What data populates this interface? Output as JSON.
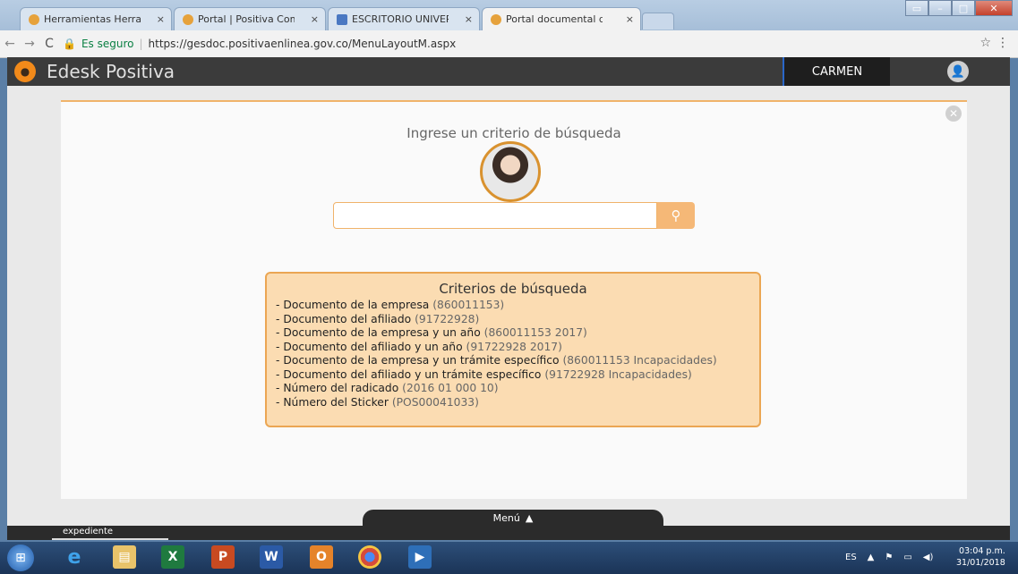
{
  "browser": {
    "tabs": [
      {
        "title": "Herramientas Herramien",
        "icon": "orange-circle-icon"
      },
      {
        "title": "Portal | Positiva Compañ",
        "icon": "orange-circle-icon"
      },
      {
        "title": "ESCRITORIO UNIVERSAL",
        "icon": "blue-window-icon"
      },
      {
        "title": "Portal documental de Po",
        "icon": "orange-circle-icon"
      }
    ],
    "tab_close": "×",
    "secure_label": "Es seguro",
    "url": "https://gesdoc.positivaenlinea.gov.co/MenuLayoutM.aspx"
  },
  "app": {
    "title": "Edesk Positiva",
    "user": "CARMEN"
  },
  "search": {
    "prompt": "Ingrese un criterio de búsqueda",
    "value": "",
    "placeholder": ""
  },
  "criteria": {
    "title": "Criterios de búsqueda",
    "items": [
      {
        "label": "- Documento de la empresa",
        "example": "(860011153)"
      },
      {
        "label": "- Documento del afiliado",
        "example": "(91722928)"
      },
      {
        "label": "- Documento de la empresa y un año",
        "example": "(860011153 2017)"
      },
      {
        "label": "- Documento del afiliado y un año",
        "example": "(91722928 2017)"
      },
      {
        "label": "- Documento de la empresa y un trámite específico",
        "example": "(860011153 Incapacidades)"
      },
      {
        "label": "- Documento del afiliado y un trámite específico",
        "example": "(91722928 Incapacidades)"
      },
      {
        "label": "- Número del radicado",
        "example": "(2016 01 000 10)"
      },
      {
        "label": "- Número del Sticker",
        "example": "(POS00041033)"
      }
    ]
  },
  "footer": {
    "menu_label": "Menú",
    "active_tab": "expediente"
  },
  "taskbar": {
    "language": "ES",
    "time": "03:04 p.m.",
    "date": "31/01/2018"
  },
  "colors": {
    "accent": "#f28a1a",
    "criteria_bg": "#fbdcb2",
    "header_bg": "#3b3b3b"
  }
}
